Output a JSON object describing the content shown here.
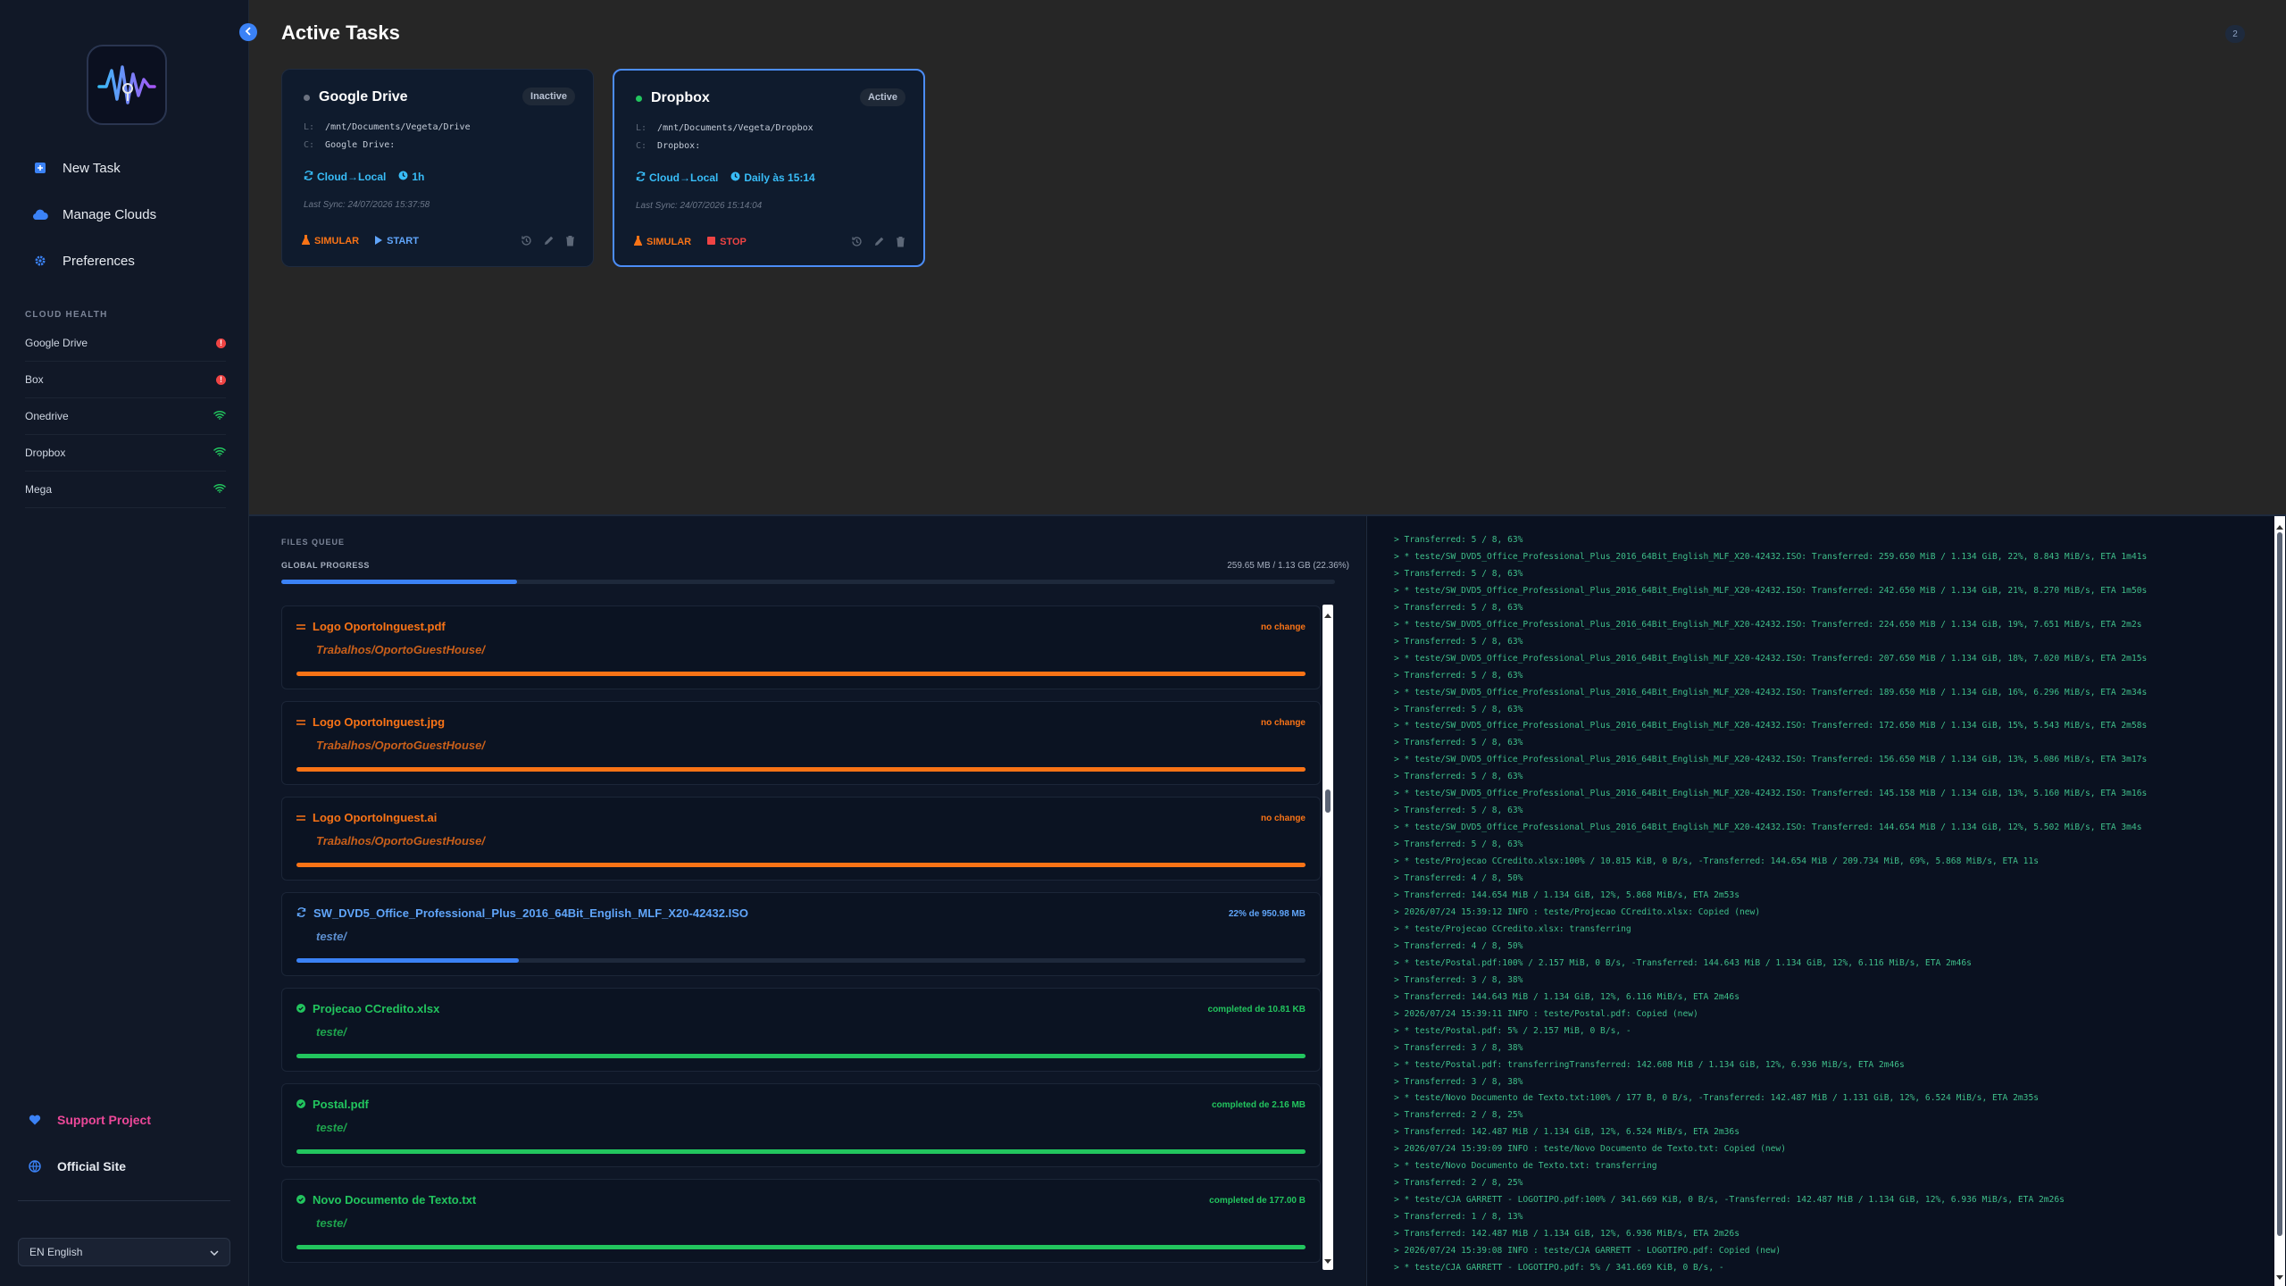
{
  "sidebar": {
    "nav": [
      {
        "label": "New Task",
        "icon": "plus-square-icon"
      },
      {
        "label": "Manage Clouds",
        "icon": "cloud-icon"
      },
      {
        "label": "Preferences",
        "icon": "gear-icon"
      }
    ],
    "health_title": "CLOUD HEALTH",
    "health": [
      {
        "name": "Google Drive",
        "status": "error"
      },
      {
        "name": "Box",
        "status": "error"
      },
      {
        "name": "Onedrive",
        "status": "ok"
      },
      {
        "name": "Dropbox",
        "status": "ok"
      },
      {
        "name": "Mega",
        "status": "ok"
      }
    ],
    "support_label": "Support Project",
    "site_label": "Official Site",
    "language": "EN English"
  },
  "header": {
    "title": "Active Tasks",
    "count": "2"
  },
  "tasks": [
    {
      "name": "Google Drive",
      "status": "Inactive",
      "local_key": "L:",
      "local_path": "/mnt/Documents/Vegeta/Drive",
      "cloud_key": "C:",
      "cloud_path": "Google Drive:",
      "direction": "Cloud→Local",
      "schedule": "1h",
      "last_sync": "Last Sync: 24/07/2026 15:37:58",
      "simulate_label": "SIMULAR",
      "run_label": "START"
    },
    {
      "name": "Dropbox",
      "status": "Active",
      "local_key": "L:",
      "local_path": "/mnt/Documents/Vegeta/Dropbox",
      "cloud_key": "C:",
      "cloud_path": "Dropbox:",
      "direction": "Cloud→Local",
      "schedule": "Daily às 15:14",
      "last_sync": "Last Sync: 24/07/2026 15:14:04",
      "simulate_label": "SIMULAR",
      "run_label": "STOP"
    }
  ],
  "queue": {
    "title": "FILES QUEUE",
    "global_label": "GLOBAL PROGRESS",
    "global_value": "259.65 MB / 1.13 GB (22.36%)",
    "global_progress": 0.2236,
    "files": [
      {
        "name": "Logo OportoInguest.pdf",
        "dir": "Trabalhos/OportoGuestHouse/",
        "status": "no change",
        "state": "nochange",
        "progress": 1.0
      },
      {
        "name": "Logo OportoInguest.jpg",
        "dir": "Trabalhos/OportoGuestHouse/",
        "status": "no change",
        "state": "nochange",
        "progress": 1.0
      },
      {
        "name": "Logo OportoInguest.ai",
        "dir": "Trabalhos/OportoGuestHouse/",
        "status": "no change",
        "state": "nochange",
        "progress": 1.0
      },
      {
        "name": "SW_DVD5_Office_Professional_Plus_2016_64Bit_English_MLF_X20-42432.ISO",
        "dir": "teste/",
        "status": "22% de 950.98 MB",
        "state": "transferring",
        "progress": 0.22
      },
      {
        "name": "Projecao CCredito.xlsx",
        "dir": "teste/",
        "status": "completed de 10.81 KB",
        "state": "completed",
        "progress": 1.0
      },
      {
        "name": "Postal.pdf",
        "dir": "teste/",
        "status": "completed de 2.16 MB",
        "state": "completed",
        "progress": 1.0
      },
      {
        "name": "Novo Documento de Texto.txt",
        "dir": "teste/",
        "status": "completed de 177.00 B",
        "state": "completed",
        "progress": 1.0
      }
    ]
  },
  "log": [
    "> Transferred: 5 / 8, 63%",
    "> * teste/SW_DVD5_Office_Professional_Plus_2016_64Bit_English_MLF_X20-42432.ISO: Transferred: 259.650 MiB / 1.134 GiB, 22%, 8.843 MiB/s, ETA 1m41s",
    "> Transferred: 5 / 8, 63%",
    "> * teste/SW_DVD5_Office_Professional_Plus_2016_64Bit_English_MLF_X20-42432.ISO: Transferred: 242.650 MiB / 1.134 GiB, 21%, 8.270 MiB/s, ETA 1m50s",
    "> Transferred: 5 / 8, 63%",
    "> * teste/SW_DVD5_Office_Professional_Plus_2016_64Bit_English_MLF_X20-42432.ISO: Transferred: 224.650 MiB / 1.134 GiB, 19%, 7.651 MiB/s, ETA 2m2s",
    "> Transferred: 5 / 8, 63%",
    "> * teste/SW_DVD5_Office_Professional_Plus_2016_64Bit_English_MLF_X20-42432.ISO: Transferred: 207.650 MiB / 1.134 GiB, 18%, 7.020 MiB/s, ETA 2m15s",
    "> Transferred: 5 / 8, 63%",
    "> * teste/SW_DVD5_Office_Professional_Plus_2016_64Bit_English_MLF_X20-42432.ISO: Transferred: 189.650 MiB / 1.134 GiB, 16%, 6.296 MiB/s, ETA 2m34s",
    "> Transferred: 5 / 8, 63%",
    "> * teste/SW_DVD5_Office_Professional_Plus_2016_64Bit_English_MLF_X20-42432.ISO: Transferred: 172.650 MiB / 1.134 GiB, 15%, 5.543 MiB/s, ETA 2m58s",
    "> Transferred: 5 / 8, 63%",
    "> * teste/SW_DVD5_Office_Professional_Plus_2016_64Bit_English_MLF_X20-42432.ISO: Transferred: 156.650 MiB / 1.134 GiB, 13%, 5.086 MiB/s, ETA 3m17s",
    "> Transferred: 5 / 8, 63%",
    "> * teste/SW_DVD5_Office_Professional_Plus_2016_64Bit_English_MLF_X20-42432.ISO: Transferred: 145.158 MiB / 1.134 GiB, 13%, 5.160 MiB/s, ETA 3m16s",
    "> Transferred: 5 / 8, 63%",
    "> * teste/SW_DVD5_Office_Professional_Plus_2016_64Bit_English_MLF_X20-42432.ISO: Transferred: 144.654 MiB / 1.134 GiB, 12%, 5.502 MiB/s, ETA 3m4s",
    "> Transferred: 5 / 8, 63%",
    "> * teste/Projecao CCredito.xlsx:100% / 10.815 KiB, 0 B/s, -Transferred: 144.654 MiB / 209.734 MiB, 69%, 5.868 MiB/s, ETA 11s",
    "> Transferred: 4 / 8, 50%",
    "> Transferred: 144.654 MiB / 1.134 GiB, 12%, 5.868 MiB/s, ETA 2m53s",
    "> 2026/07/24 15:39:12 INFO : teste/Projecao CCredito.xlsx: Copied (new)",
    "> * teste/Projecao CCredito.xlsx: transferring",
    "> Transferred: 4 / 8, 50%",
    "> * teste/Postal.pdf:100% / 2.157 MiB, 0 B/s, -Transferred: 144.643 MiB / 1.134 GiB, 12%, 6.116 MiB/s, ETA 2m46s",
    "> Transferred: 3 / 8, 38%",
    "> Transferred: 144.643 MiB / 1.134 GiB, 12%, 6.116 MiB/s, ETA 2m46s",
    "> 2026/07/24 15:39:11 INFO : teste/Postal.pdf: Copied (new)",
    "> * teste/Postal.pdf: 5% / 2.157 MiB, 0 B/s, -",
    "> Transferred: 3 / 8, 38%",
    "> * teste/Postal.pdf: transferringTransferred: 142.608 MiB / 1.134 GiB, 12%, 6.936 MiB/s, ETA 2m46s",
    "> Transferred: 3 / 8, 38%",
    "> * teste/Novo Documento de Texto.txt:100% / 177 B, 0 B/s, -Transferred: 142.487 MiB / 1.131 GiB, 12%, 6.524 MiB/s, ETA 2m35s",
    "> Transferred: 2 / 8, 25%",
    "> Transferred: 142.487 MiB / 1.134 GiB, 12%, 6.524 MiB/s, ETA 2m36s",
    "> 2026/07/24 15:39:09 INFO : teste/Novo Documento de Texto.txt: Copied (new)",
    "> * teste/Novo Documento de Texto.txt: transferring",
    "> Transferred: 2 / 8, 25%",
    "> * teste/CJA GARRETT - LOGOTIPO.pdf:100% / 341.669 KiB, 0 B/s, -Transferred: 142.487 MiB / 1.134 GiB, 12%, 6.936 MiB/s, ETA 2m26s",
    "> Transferred: 1 / 8, 13%",
    "> Transferred: 142.487 MiB / 1.134 GiB, 12%, 6.936 MiB/s, ETA 2m26s",
    "> 2026/07/24 15:39:08 INFO : teste/CJA GARRETT - LOGOTIPO.pdf: Copied (new)",
    "> * teste/CJA GARRETT - LOGOTIPO.pdf: 5% / 341.669 KiB, 0 B/s, -"
  ],
  "colors": {
    "accent": "#3b82f6",
    "active_green": "#22c55e",
    "error_red": "#ef4444",
    "warning_orange": "#f97316",
    "log_green": "#3fbf8a"
  }
}
